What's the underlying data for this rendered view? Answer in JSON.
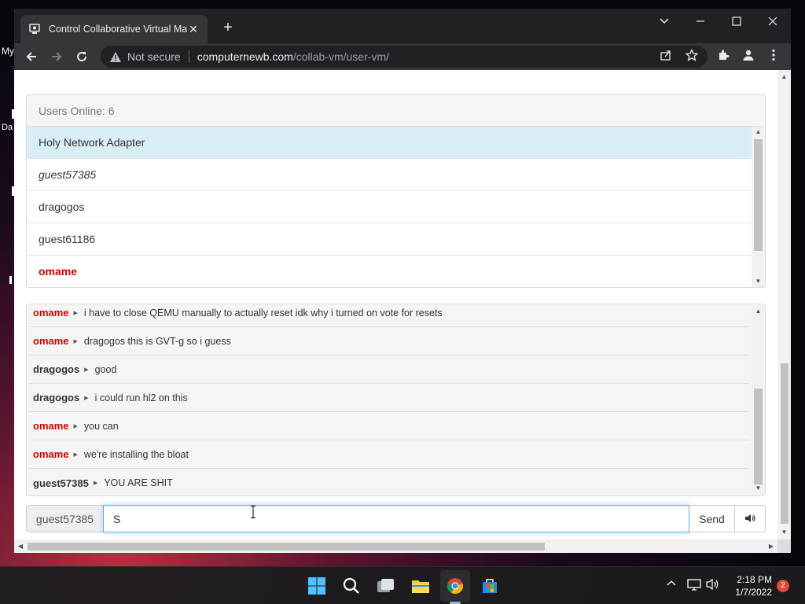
{
  "desktop": {
    "text_my": "My",
    "text_da": "Da"
  },
  "browser": {
    "tab_title": "Control Collaborative Virtual Machine",
    "security_label": "Not secure",
    "url_domain": "computernewb.com",
    "url_path": "/collab-vm/user-vm/"
  },
  "users_panel": {
    "heading": "Users Online: 6",
    "users": [
      {
        "name": "Holy Network Adapter",
        "style": "selected"
      },
      {
        "name": "guest57385",
        "style": "italic"
      },
      {
        "name": "dragogos",
        "style": "normal"
      },
      {
        "name": "guest61186",
        "style": "normal"
      },
      {
        "name": "omame",
        "style": "admin"
      }
    ]
  },
  "chat": {
    "messages": [
      {
        "user": "omame",
        "admin": true,
        "text": "i have to close QEMU manually to actually reset idk why i turned on vote for resets"
      },
      {
        "user": "omame",
        "admin": true,
        "text": "dragogos this is GVT-g so i guess"
      },
      {
        "user": "dragogos",
        "admin": false,
        "text": "good"
      },
      {
        "user": "dragogos",
        "admin": false,
        "text": "i could run hl2 on this"
      },
      {
        "user": "omame",
        "admin": true,
        "text": "you can"
      },
      {
        "user": "omame",
        "admin": true,
        "text": "we're installing the bloat"
      },
      {
        "user": "guest57385",
        "admin": false,
        "text": "YOU ARE SHIT"
      }
    ]
  },
  "input": {
    "username": "guest57385",
    "value": "S",
    "send_label": "Send",
    "volume_icon": "volume-icon"
  },
  "taskbar": {
    "time": "2:18 PM",
    "date": "1/7/2022",
    "notifications": "2"
  },
  "colors": {
    "admin": "#d30000",
    "selected_row": "#d9edf7",
    "input_focus": "#66afe9"
  }
}
